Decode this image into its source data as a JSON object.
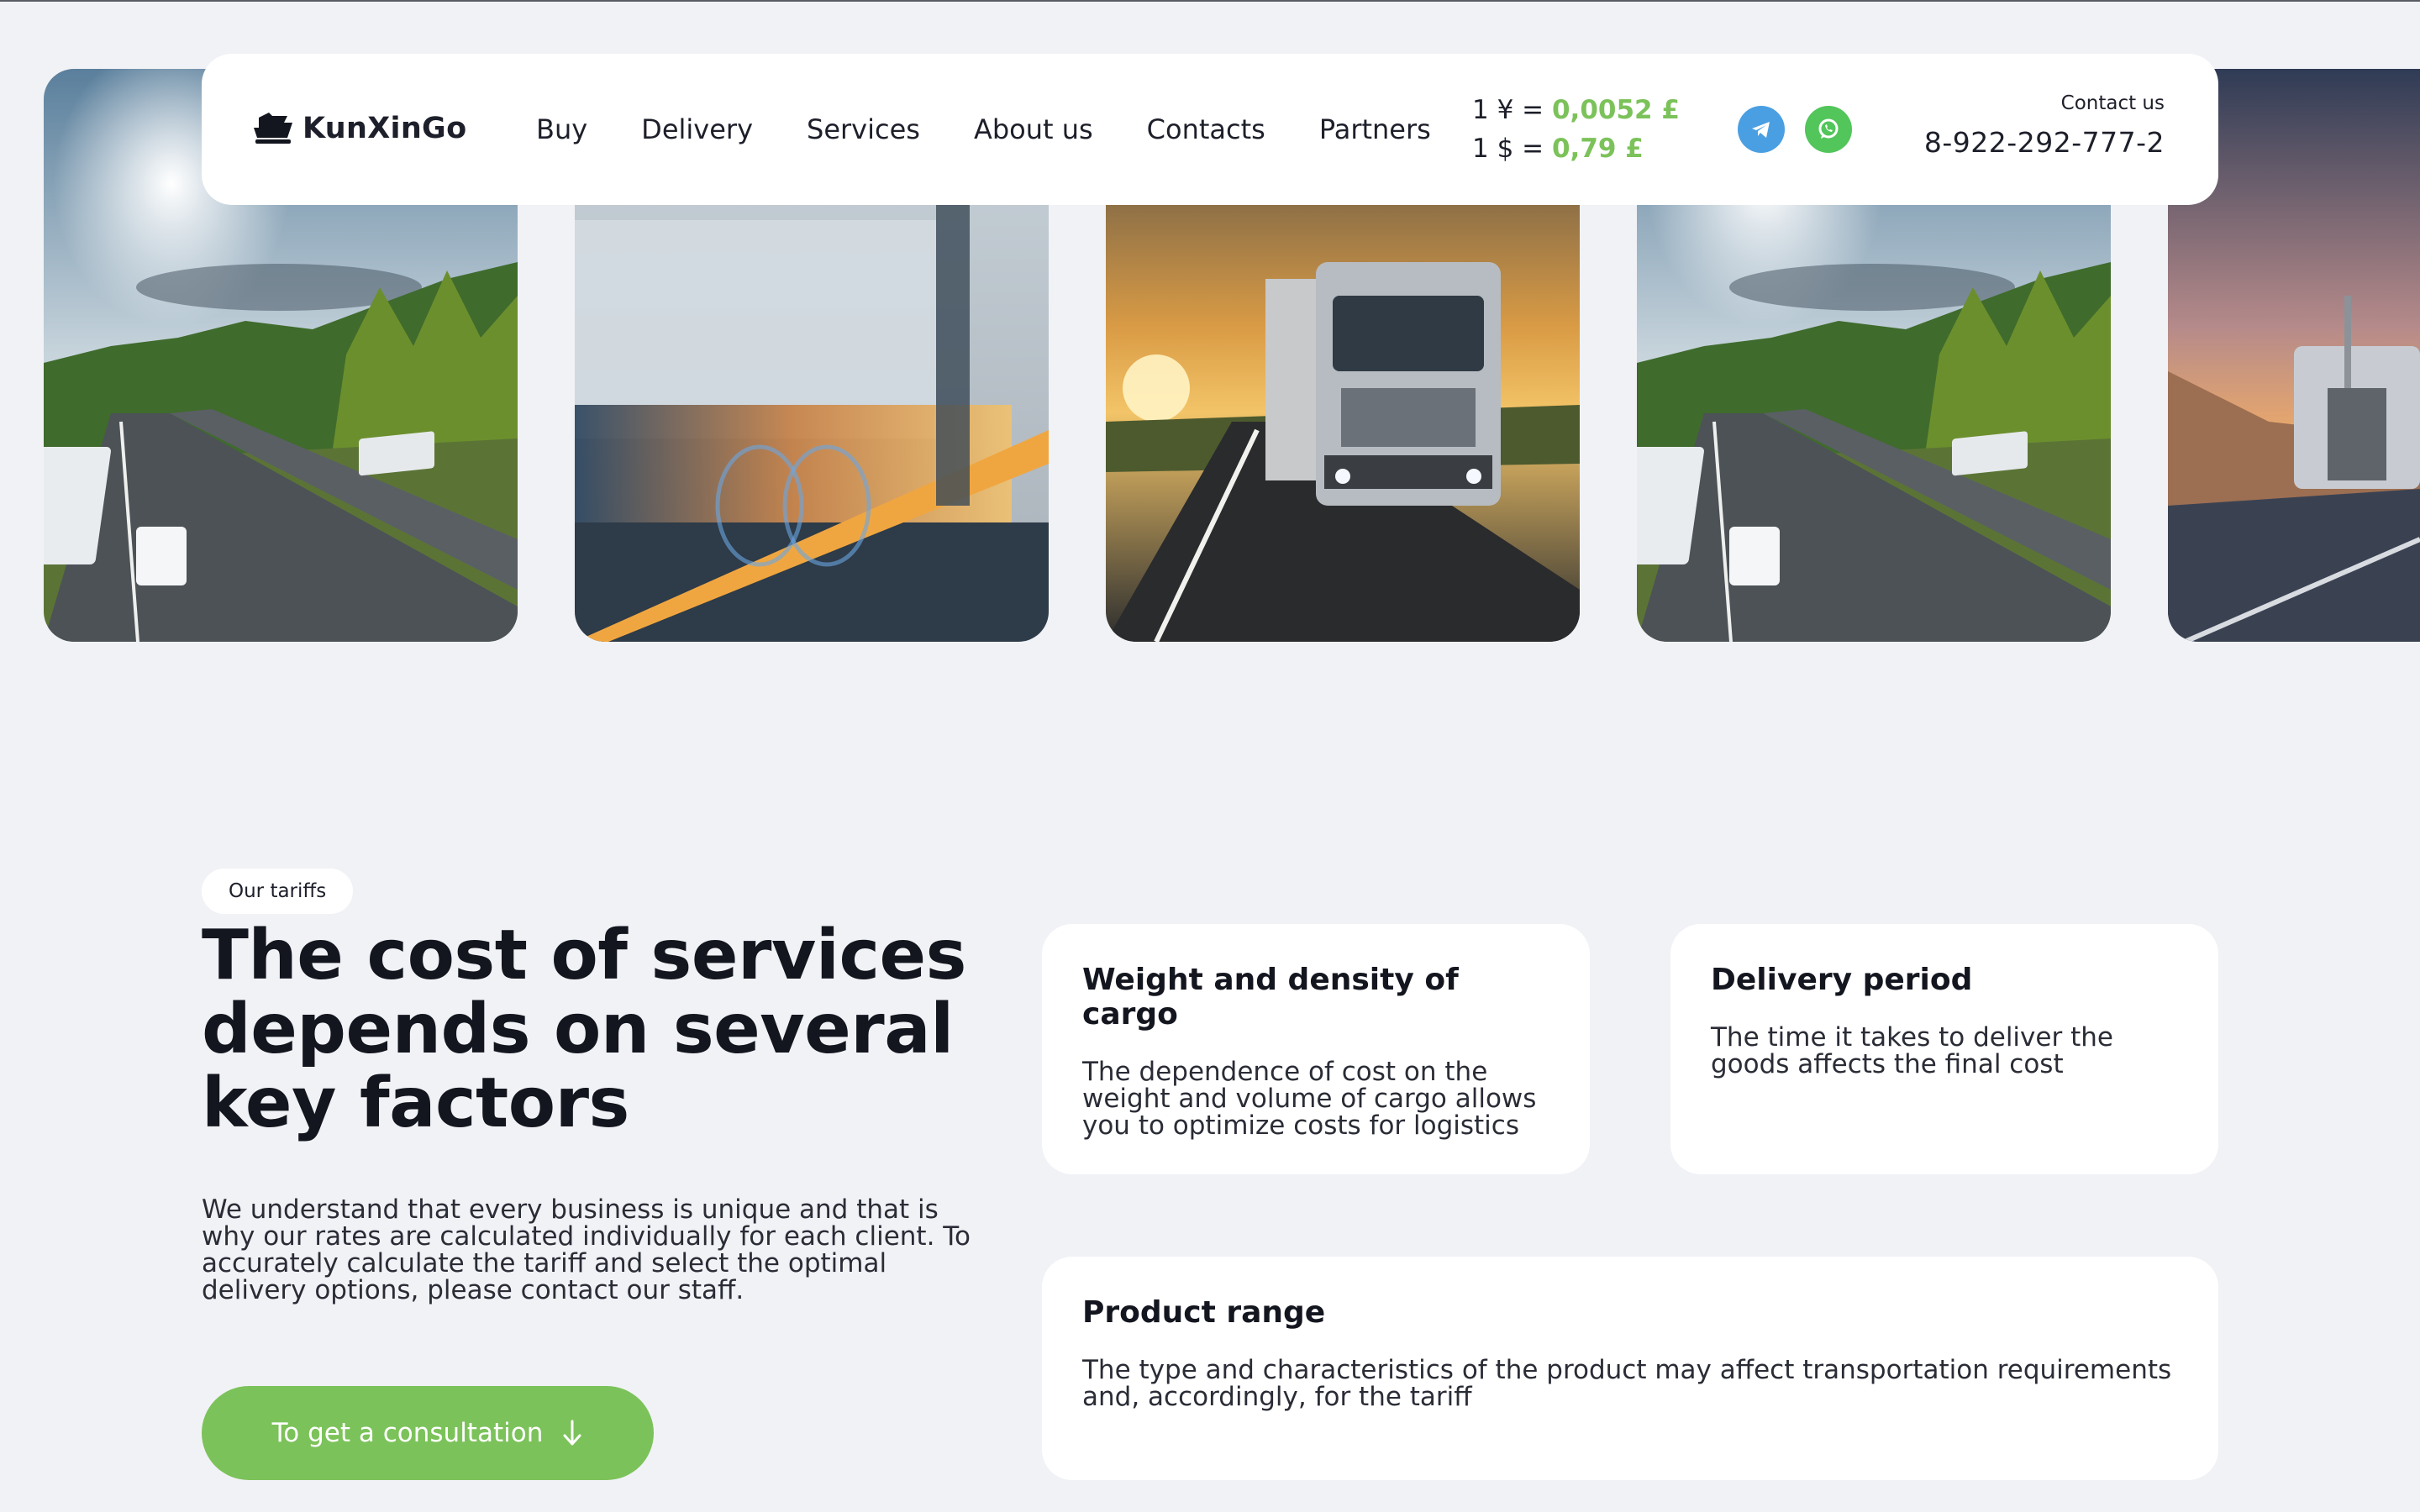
{
  "header": {
    "logo_text": "KunXinGo",
    "nav": [
      "Buy",
      "Delivery",
      "Services",
      "About us",
      "Contacts",
      "Partners"
    ],
    "rates": [
      {
        "prefix": "1 ¥ = ",
        "value": "0,0052 £"
      },
      {
        "prefix": "1 $ = ",
        "value": "0,79 £"
      }
    ],
    "contact_label": "Contact us",
    "phone": "8-922-292-777-2"
  },
  "tariffs": {
    "badge": "Our tariffs",
    "title": "The cost of services depends on several key factors",
    "description": "We understand that every business is unique and that is why our rates are calculated individually for each client. To accurately calculate the tariff and select the optimal delivery options, please contact our staff.",
    "cta_label": "To get a consultation",
    "cards": [
      {
        "title": "Weight and density of cargo",
        "text": "The dependence of cost on the weight and volume of cargo allows you to optimize costs for logistics"
      },
      {
        "title": "Delivery period",
        "text": "The time it takes to deliver the goods affects the final cost"
      },
      {
        "title": "Product range",
        "text": "The type and characteristics of the product may affect transportation requirements and, accordingly, for the tariff"
      }
    ]
  },
  "icons": {
    "logo": "ship-icon",
    "telegram": "telegram-icon",
    "whatsapp": "whatsapp-icon",
    "cta": "arrow-down-icon"
  },
  "colors": {
    "accent": "#7cc25a",
    "telegram": "#4a9fe2",
    "whatsapp": "#52c55b",
    "background": "#f1f2f6"
  }
}
